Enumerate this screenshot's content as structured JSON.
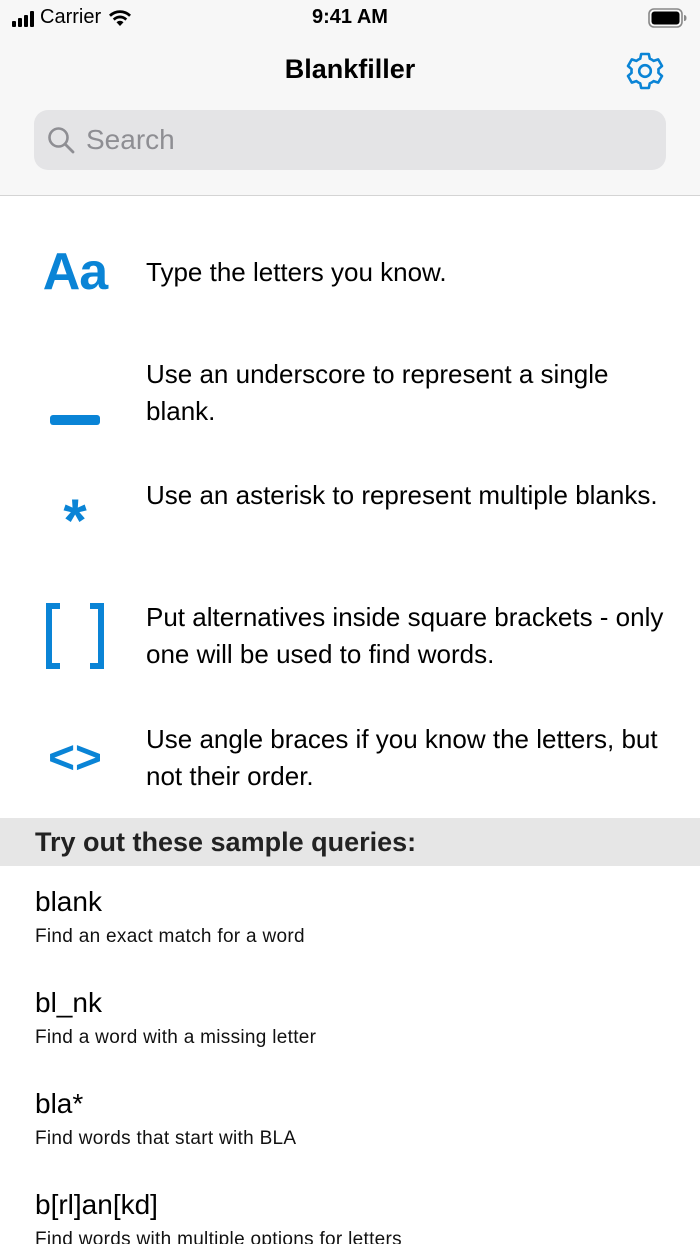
{
  "status_bar": {
    "carrier": "Carrier",
    "time": "9:41 AM"
  },
  "nav": {
    "title": "Blankfiller",
    "settings_icon": "gear-icon"
  },
  "search": {
    "placeholder": "Search",
    "value": ""
  },
  "instructions": [
    {
      "icon": "Aa",
      "text": "Type the letters you know."
    },
    {
      "icon": "underscore",
      "text": "Use an underscore to represent a single blank."
    },
    {
      "icon": "*",
      "text": "Use an asterisk to represent multiple blanks."
    },
    {
      "icon": "[ ]",
      "text": "Put alternatives inside square brackets - only one will be used to find words."
    },
    {
      "icon": "<>",
      "text": "Use angle braces if you know the letters, but not their order."
    }
  ],
  "samples_header": "Try out these sample queries:",
  "samples": [
    {
      "query": "blank",
      "description": "Find an exact match for a word"
    },
    {
      "query": "bl_nk",
      "description": "Find a word with a missing letter"
    },
    {
      "query": "bla*",
      "description": "Find words that start with BLA"
    },
    {
      "query": "b[rl]an[kd]",
      "description": "Find words with multiple options for letters"
    }
  ],
  "colors": {
    "accent": "#0a84d6"
  }
}
